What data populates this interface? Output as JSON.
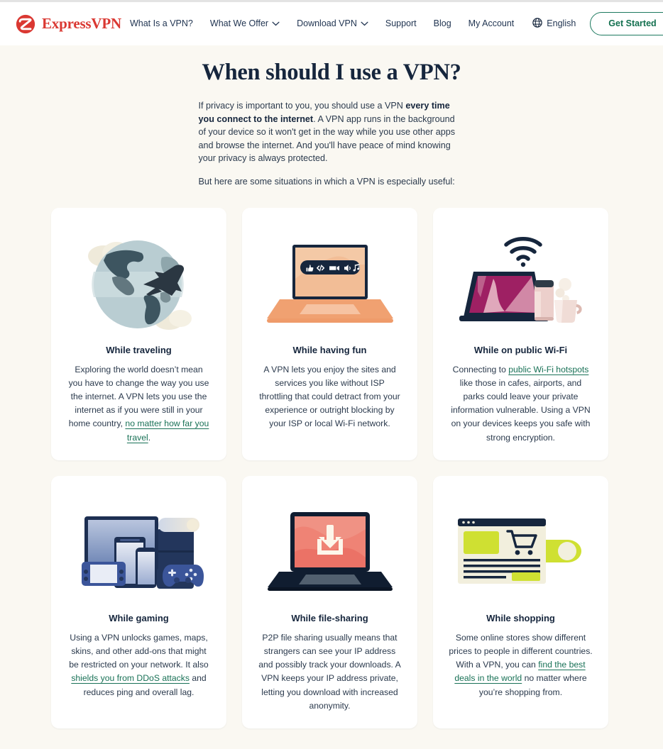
{
  "header": {
    "logo_text": "ExpressVPN",
    "logo_icon": "expressvpn-logo-icon",
    "nav": [
      {
        "label": "What Is a VPN?",
        "has_chevron": false
      },
      {
        "label": "What We Offer",
        "has_chevron": true
      },
      {
        "label": "Download VPN",
        "has_chevron": true
      },
      {
        "label": "Support",
        "has_chevron": false
      },
      {
        "label": "Blog",
        "has_chevron": false
      },
      {
        "label": "My Account",
        "has_chevron": false
      }
    ],
    "language": {
      "label": "English",
      "icon": "globe-icon"
    },
    "cta": {
      "label": "Get Started"
    }
  },
  "intro": {
    "title": "When should I use a VPN?",
    "p1_a": "If privacy is important to you, you should use a VPN ",
    "p1_bold": "every time you connect to the internet",
    "p1_b": ". A VPN app runs in the background of your device so it won't get in the way while you use other apps and browse the internet. And you'll have peace of mind knowing your privacy is always protected.",
    "p2": "But here are some situations in which a VPN is especially useful:"
  },
  "cards": [
    {
      "art": "globe-airplane-clouds-illustration",
      "title": "While traveling",
      "body_a": "Exploring the world doesn’t mean you have to change the way you use the internet. A VPN lets you use the internet as if you were still in your home country, ",
      "link": "no matter how far you travel",
      "body_b": "."
    },
    {
      "art": "laptop-media-icons-illustration",
      "title": "While having fun",
      "body_a": "A VPN lets you enjoy the sites and services you like without ISP throttling that could detract from your experience or outright blocking by your ISP or local Wi-Fi network.",
      "link": "",
      "body_b": ""
    },
    {
      "art": "laptop-wifi-coffee-illustration",
      "title": "While on public Wi-Fi",
      "body_a": "Connecting to ",
      "link": "public Wi-Fi hotspots",
      "body_b": " like those in cafes, airports, and parks could leave your private information vulnerable. Using a VPN on your devices keeps you safe with strong encryption."
    },
    {
      "art": "gaming-devices-illustration",
      "title": "While gaming",
      "body_a": "Using a VPN unlocks games, maps, skins, and other add-ons that might be restricted on your network. It also ",
      "link": "shields you from DDoS attacks",
      "body_b": " and reduces ping and overall lag."
    },
    {
      "art": "laptop-download-illustration",
      "title": "While file-sharing",
      "body_a": "P2P file sharing usually means that strangers can see your IP address and possibly track your downloads. A VPN keeps your IP address private, letting you download with increased anonymity.",
      "link": "",
      "body_b": ""
    },
    {
      "art": "browser-shopping-cart-illustration",
      "title": "While shopping",
      "body_a": "Some online stores show different prices to people in different countries. With a VPN, you can ",
      "link": "find the best deals in the world",
      "body_b": " no matter where you’re shopping from."
    }
  ],
  "media_icons": [
    "thumbs-up-icon",
    "code-icon",
    "video-camera-icon",
    "speaker-icon",
    "music-note-icon"
  ],
  "colors": {
    "page_bg": "#faf8f2",
    "header_bg": "#ffffff",
    "card_bg": "#ffffff",
    "brand_red": "#da3832",
    "heading_navy": "#16263d",
    "link_green": "#187156",
    "cta_green": "#13704f"
  }
}
